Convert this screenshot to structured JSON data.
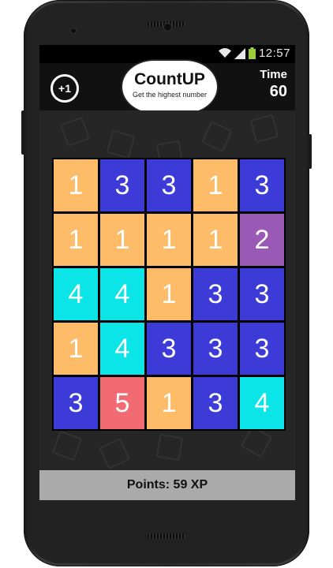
{
  "status_bar": {
    "time": "12:57",
    "icons": [
      "wifi-icon",
      "signal-icon",
      "battery-icon"
    ]
  },
  "app": {
    "title": "CountUP",
    "subtitle": "Get the highest number",
    "bonus_button_label": "+1",
    "timer_label": "Time",
    "timer_value": "60"
  },
  "colors": {
    "1": "#FEBB68",
    "2": "#9B59B6",
    "3": "#3D3BD8",
    "4": "#0CE5E8",
    "5": "#F26B72"
  },
  "board": [
    [
      "1",
      "3",
      "3",
      "1",
      "3"
    ],
    [
      "1",
      "1",
      "1",
      "1",
      "2"
    ],
    [
      "4",
      "4",
      "1",
      "3",
      "3"
    ],
    [
      "1",
      "4",
      "3",
      "3",
      "3"
    ],
    [
      "3",
      "5",
      "1",
      "3",
      "4"
    ]
  ],
  "footer": {
    "points_text": "Points: 59 XP"
  }
}
